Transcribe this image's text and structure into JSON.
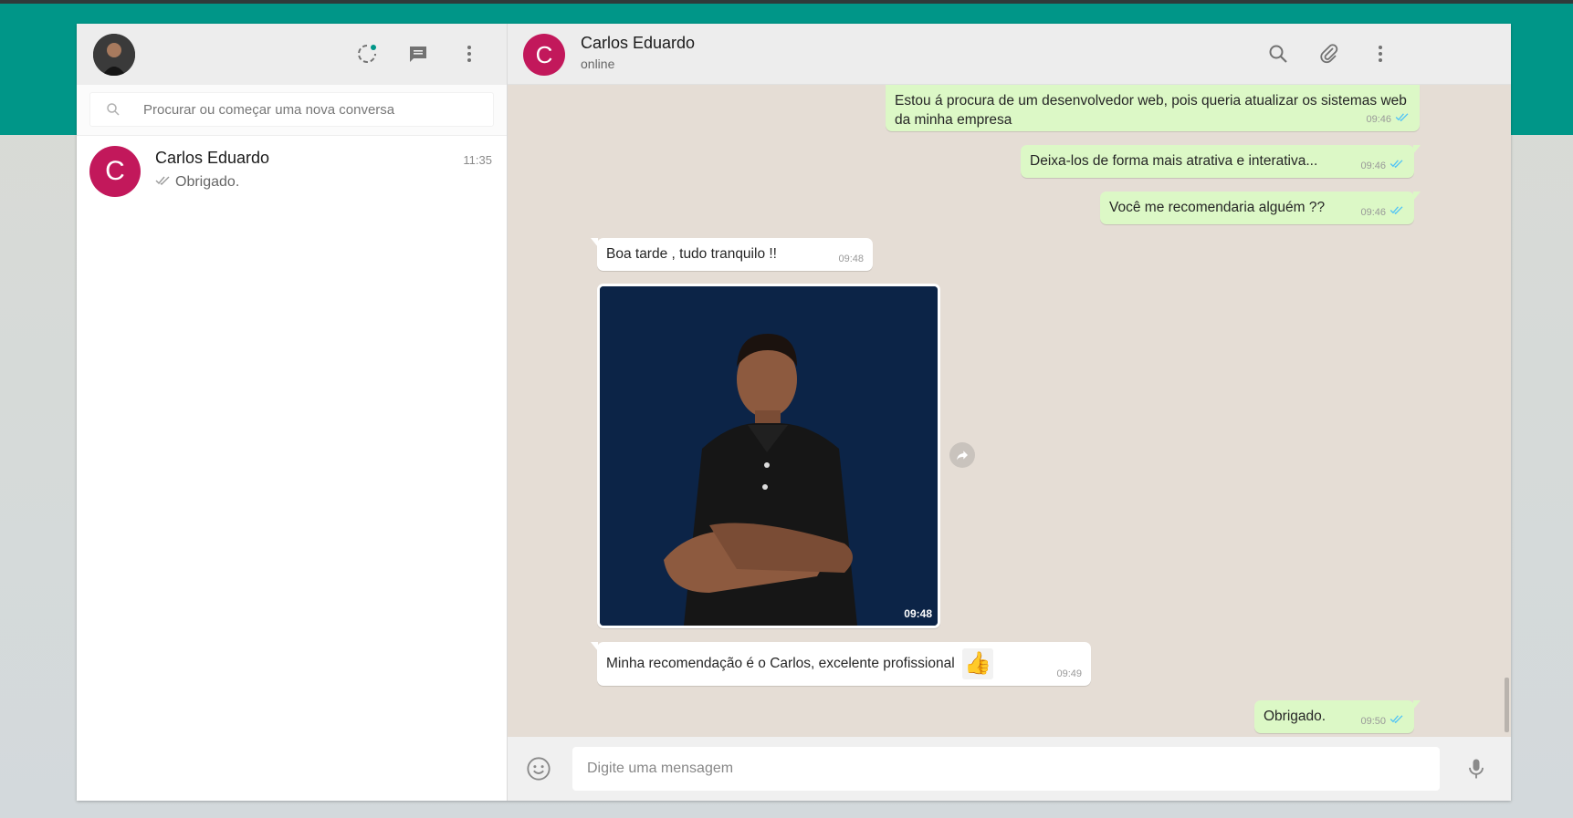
{
  "sidebar": {
    "search_placeholder": "Procurar ou começar uma nova conversa",
    "chats": [
      {
        "avatar_letter": "C",
        "name": "Carlos Eduardo",
        "time": "11:35",
        "preview": "Obrigado."
      }
    ]
  },
  "conversation": {
    "avatar_letter": "C",
    "contact_name": "Carlos Eduardo",
    "status": "online",
    "messages": [
      {
        "direction": "out",
        "text": "Estou á procura de um desenvolvedor web, pois queria atualizar os sistemas web da minha empresa",
        "time": "09:46"
      },
      {
        "direction": "out",
        "text": "Deixa-los de forma mais atrativa e interativa...",
        "time": "09:46"
      },
      {
        "direction": "out",
        "text": "Você me recomendaria alguém ??",
        "time": "09:46"
      },
      {
        "direction": "in",
        "text": "Boa tarde , tudo tranquilo !!",
        "time": "09:48"
      },
      {
        "direction": "in",
        "type": "image",
        "time": "09:48"
      },
      {
        "direction": "in",
        "text": "Minha recomendação é o Carlos, excelente profissional",
        "time": "09:49"
      },
      {
        "direction": "out",
        "text": "Obrigado.",
        "time": "09:50"
      }
    ],
    "composer_placeholder": "Digite uma mensagem"
  },
  "colors": {
    "brand_band": "#009688",
    "avatar": "#c2185b",
    "outgoing_bubble": "#dcf8c6",
    "chat_background": "#e5ddd5",
    "read_ticks": "#4fc3f7"
  },
  "icons": [
    "search-icon",
    "paperclip-icon",
    "menu-dots-icon",
    "status-icon",
    "new-chat-icon",
    "emoji-icon",
    "mic-icon",
    "forward-icon",
    "double-check-icon"
  ]
}
